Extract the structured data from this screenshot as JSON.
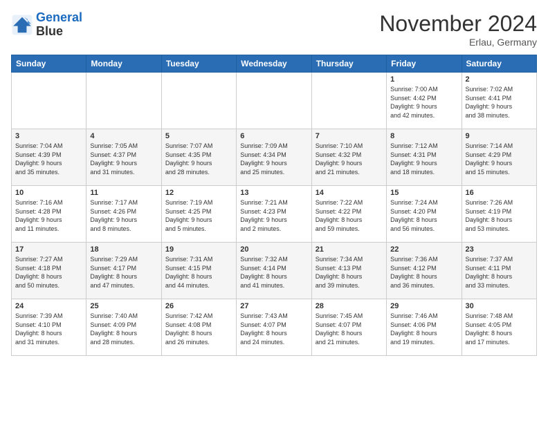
{
  "logo": {
    "line1": "General",
    "line2": "Blue"
  },
  "title": "November 2024",
  "location": "Erlau, Germany",
  "days_header": [
    "Sunday",
    "Monday",
    "Tuesday",
    "Wednesday",
    "Thursday",
    "Friday",
    "Saturday"
  ],
  "weeks": [
    [
      {
        "day": "",
        "info": ""
      },
      {
        "day": "",
        "info": ""
      },
      {
        "day": "",
        "info": ""
      },
      {
        "day": "",
        "info": ""
      },
      {
        "day": "",
        "info": ""
      },
      {
        "day": "1",
        "info": "Sunrise: 7:00 AM\nSunset: 4:42 PM\nDaylight: 9 hours\nand 42 minutes."
      },
      {
        "day": "2",
        "info": "Sunrise: 7:02 AM\nSunset: 4:41 PM\nDaylight: 9 hours\nand 38 minutes."
      }
    ],
    [
      {
        "day": "3",
        "info": "Sunrise: 7:04 AM\nSunset: 4:39 PM\nDaylight: 9 hours\nand 35 minutes."
      },
      {
        "day": "4",
        "info": "Sunrise: 7:05 AM\nSunset: 4:37 PM\nDaylight: 9 hours\nand 31 minutes."
      },
      {
        "day": "5",
        "info": "Sunrise: 7:07 AM\nSunset: 4:35 PM\nDaylight: 9 hours\nand 28 minutes."
      },
      {
        "day": "6",
        "info": "Sunrise: 7:09 AM\nSunset: 4:34 PM\nDaylight: 9 hours\nand 25 minutes."
      },
      {
        "day": "7",
        "info": "Sunrise: 7:10 AM\nSunset: 4:32 PM\nDaylight: 9 hours\nand 21 minutes."
      },
      {
        "day": "8",
        "info": "Sunrise: 7:12 AM\nSunset: 4:31 PM\nDaylight: 9 hours\nand 18 minutes."
      },
      {
        "day": "9",
        "info": "Sunrise: 7:14 AM\nSunset: 4:29 PM\nDaylight: 9 hours\nand 15 minutes."
      }
    ],
    [
      {
        "day": "10",
        "info": "Sunrise: 7:16 AM\nSunset: 4:28 PM\nDaylight: 9 hours\nand 11 minutes."
      },
      {
        "day": "11",
        "info": "Sunrise: 7:17 AM\nSunset: 4:26 PM\nDaylight: 9 hours\nand 8 minutes."
      },
      {
        "day": "12",
        "info": "Sunrise: 7:19 AM\nSunset: 4:25 PM\nDaylight: 9 hours\nand 5 minutes."
      },
      {
        "day": "13",
        "info": "Sunrise: 7:21 AM\nSunset: 4:23 PM\nDaylight: 9 hours\nand 2 minutes."
      },
      {
        "day": "14",
        "info": "Sunrise: 7:22 AM\nSunset: 4:22 PM\nDaylight: 8 hours\nand 59 minutes."
      },
      {
        "day": "15",
        "info": "Sunrise: 7:24 AM\nSunset: 4:20 PM\nDaylight: 8 hours\nand 56 minutes."
      },
      {
        "day": "16",
        "info": "Sunrise: 7:26 AM\nSunset: 4:19 PM\nDaylight: 8 hours\nand 53 minutes."
      }
    ],
    [
      {
        "day": "17",
        "info": "Sunrise: 7:27 AM\nSunset: 4:18 PM\nDaylight: 8 hours\nand 50 minutes."
      },
      {
        "day": "18",
        "info": "Sunrise: 7:29 AM\nSunset: 4:17 PM\nDaylight: 8 hours\nand 47 minutes."
      },
      {
        "day": "19",
        "info": "Sunrise: 7:31 AM\nSunset: 4:15 PM\nDaylight: 8 hours\nand 44 minutes."
      },
      {
        "day": "20",
        "info": "Sunrise: 7:32 AM\nSunset: 4:14 PM\nDaylight: 8 hours\nand 41 minutes."
      },
      {
        "day": "21",
        "info": "Sunrise: 7:34 AM\nSunset: 4:13 PM\nDaylight: 8 hours\nand 39 minutes."
      },
      {
        "day": "22",
        "info": "Sunrise: 7:36 AM\nSunset: 4:12 PM\nDaylight: 8 hours\nand 36 minutes."
      },
      {
        "day": "23",
        "info": "Sunrise: 7:37 AM\nSunset: 4:11 PM\nDaylight: 8 hours\nand 33 minutes."
      }
    ],
    [
      {
        "day": "24",
        "info": "Sunrise: 7:39 AM\nSunset: 4:10 PM\nDaylight: 8 hours\nand 31 minutes."
      },
      {
        "day": "25",
        "info": "Sunrise: 7:40 AM\nSunset: 4:09 PM\nDaylight: 8 hours\nand 28 minutes."
      },
      {
        "day": "26",
        "info": "Sunrise: 7:42 AM\nSunset: 4:08 PM\nDaylight: 8 hours\nand 26 minutes."
      },
      {
        "day": "27",
        "info": "Sunrise: 7:43 AM\nSunset: 4:07 PM\nDaylight: 8 hours\nand 24 minutes."
      },
      {
        "day": "28",
        "info": "Sunrise: 7:45 AM\nSunset: 4:07 PM\nDaylight: 8 hours\nand 21 minutes."
      },
      {
        "day": "29",
        "info": "Sunrise: 7:46 AM\nSunset: 4:06 PM\nDaylight: 8 hours\nand 19 minutes."
      },
      {
        "day": "30",
        "info": "Sunrise: 7:48 AM\nSunset: 4:05 PM\nDaylight: 8 hours\nand 17 minutes."
      }
    ]
  ]
}
